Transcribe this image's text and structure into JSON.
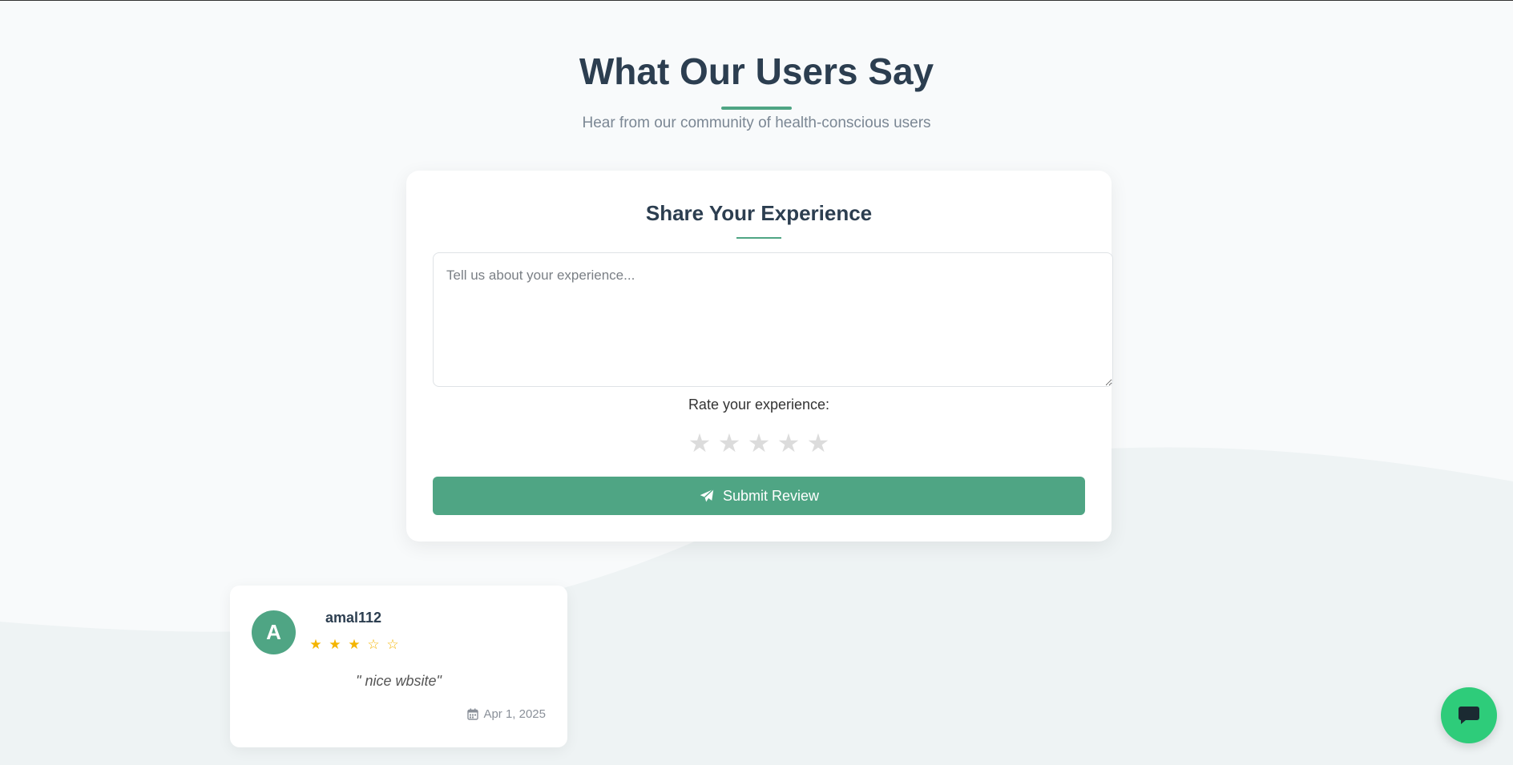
{
  "header": {
    "title": "What Our Users Say",
    "subtitle": "Hear from our community of health-conscious users"
  },
  "review_form": {
    "title": "Share Your Experience",
    "textarea_placeholder": "Tell us about your experience...",
    "textarea_value": "",
    "rating_label": "Rate your experience:",
    "rating_value": 0,
    "rating_max": 5,
    "star_glyph": "★",
    "submit_label": "Submit Review",
    "submit_icon": "paper-plane-icon"
  },
  "reviews": [
    {
      "avatar_letter": "A",
      "username": "amal112",
      "rating": 3,
      "rating_max": 5,
      "stars": [
        "★",
        "★",
        "★",
        "☆",
        "☆"
      ],
      "text": "\" nice wbsite\"",
      "date": "Apr 1, 2025",
      "date_icon": "calendar-icon"
    }
  ],
  "chat_widget": {
    "icon": "chat-bubble-icon"
  },
  "colors": {
    "accent": "#4fa584",
    "heading": "#2c3e50",
    "star_filled": "#f4b400",
    "star_empty": "#dcdcdc",
    "chat_button": "#2ecc7a",
    "background": "#f8fafb"
  }
}
